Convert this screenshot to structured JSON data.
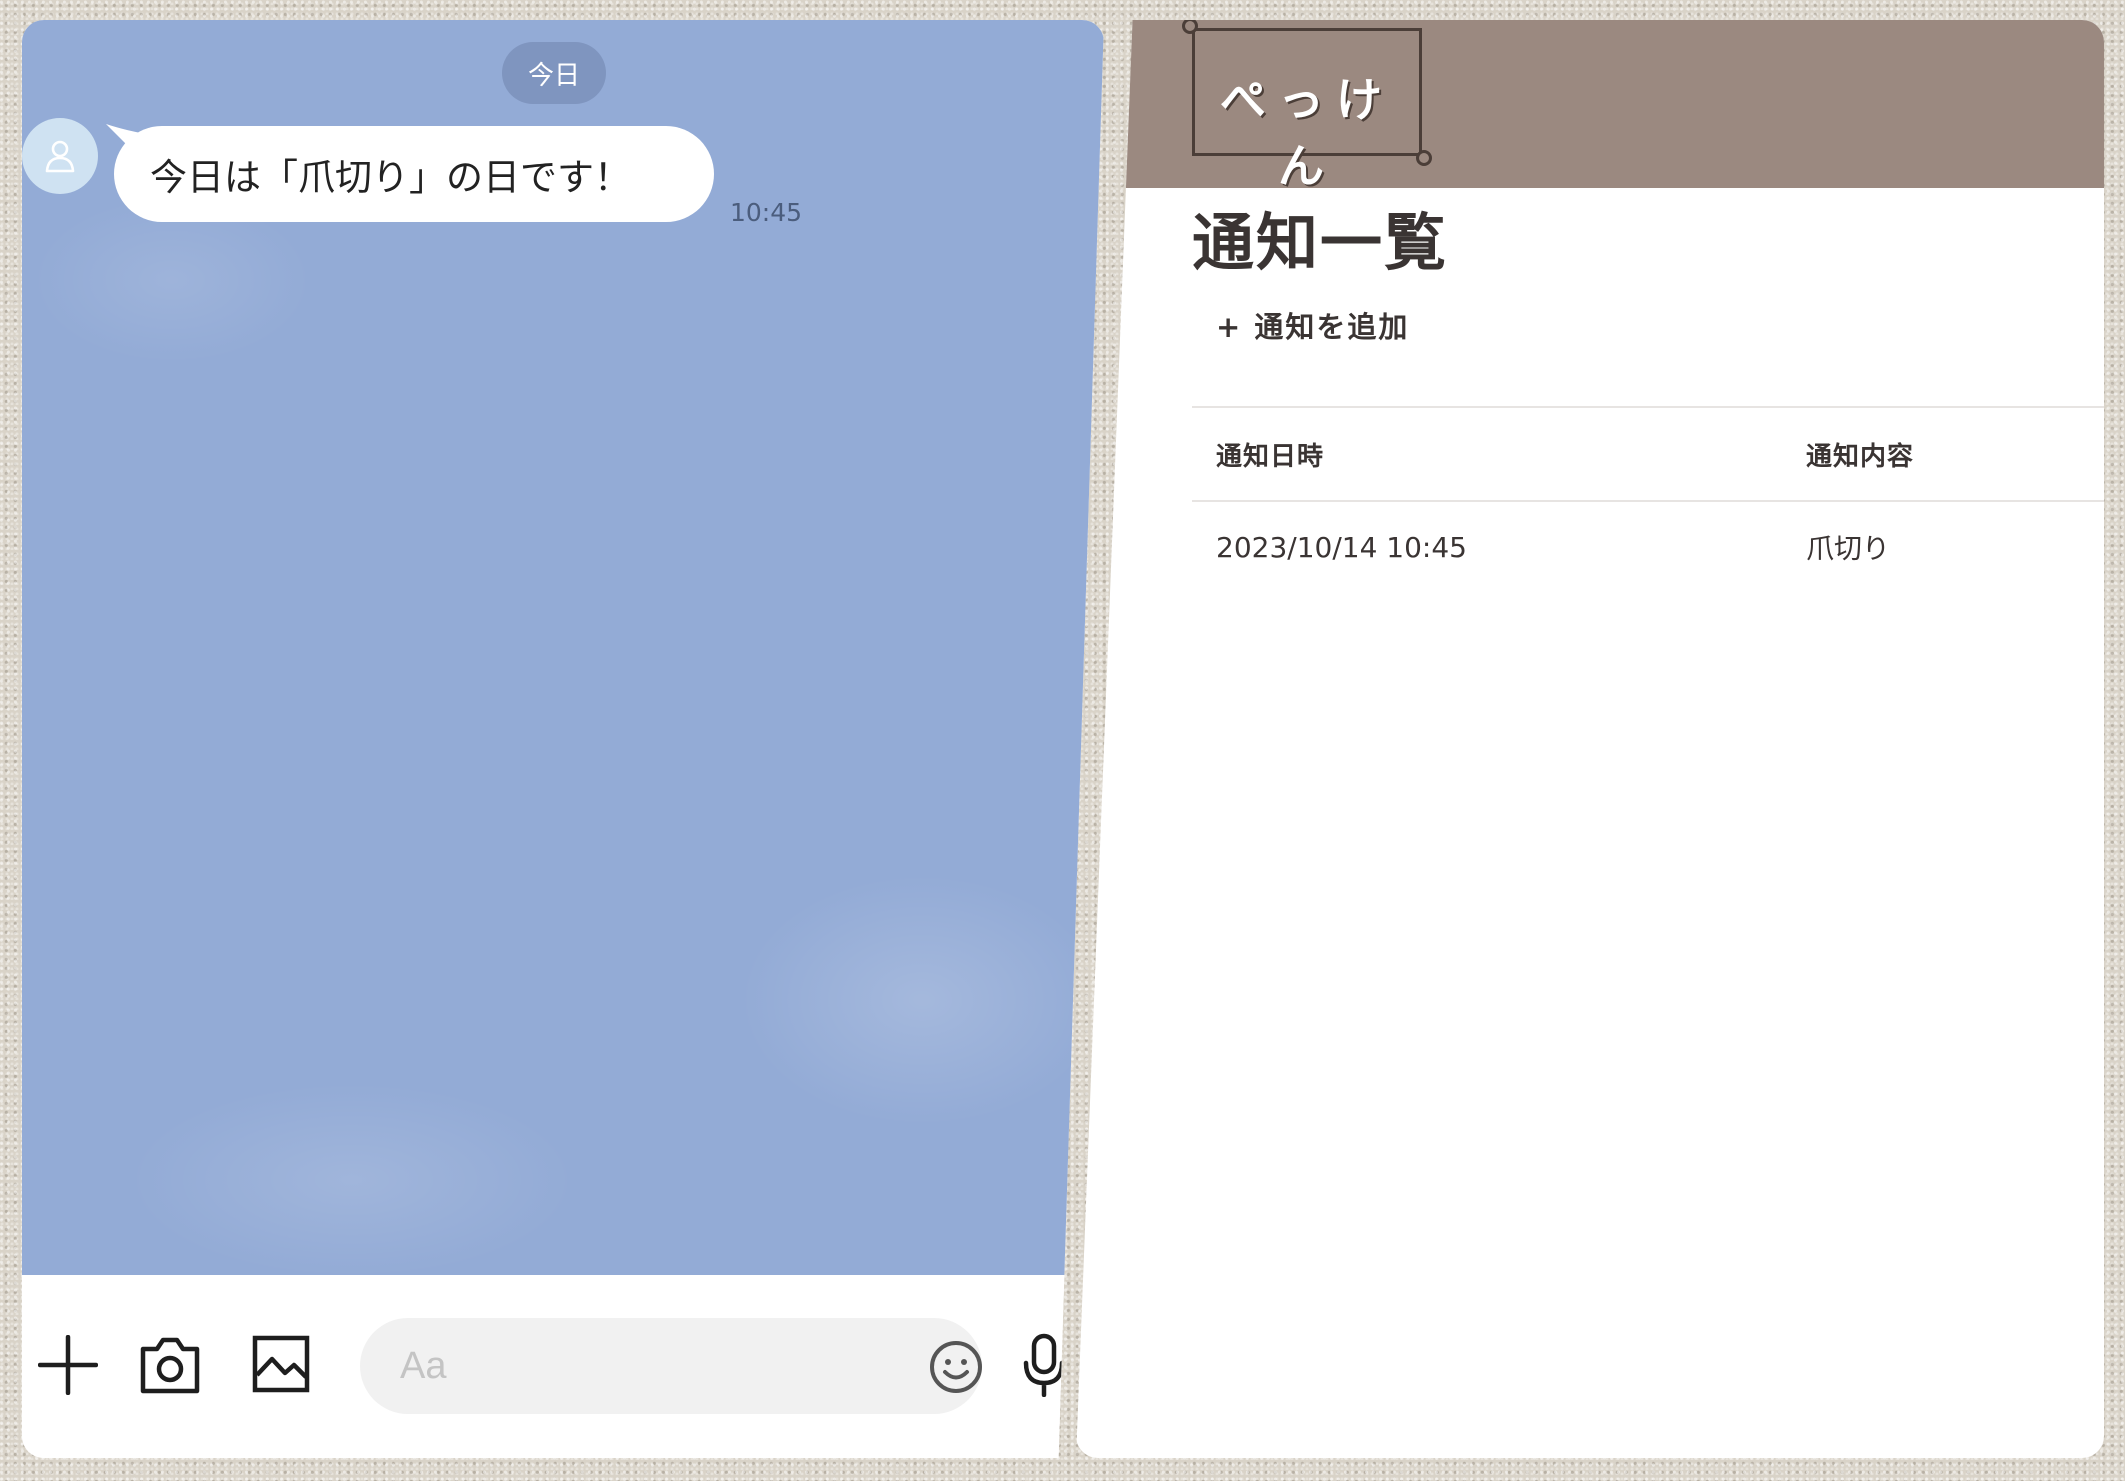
{
  "chat": {
    "date_label": "今日",
    "message": "今日は「爪切り」の日です！",
    "time": "10:45",
    "input_placeholder": "Aa"
  },
  "app": {
    "logo": "ぺっけん",
    "page_title": "通知一覧",
    "add_button": "+ 通知を追加",
    "table": {
      "headers": [
        "通知日時",
        "通知内容"
      ],
      "rows": [
        {
          "datetime": "2023/10/14 10:45",
          "content": "爪切り"
        }
      ]
    }
  },
  "colors": {
    "chat_background": "#93abd6",
    "header_brown": "#9b8980",
    "text_dark": "#3a3433"
  },
  "icons": [
    "person-icon",
    "plus-icon",
    "camera-icon",
    "image-icon",
    "emoji-icon",
    "mic-icon"
  ]
}
